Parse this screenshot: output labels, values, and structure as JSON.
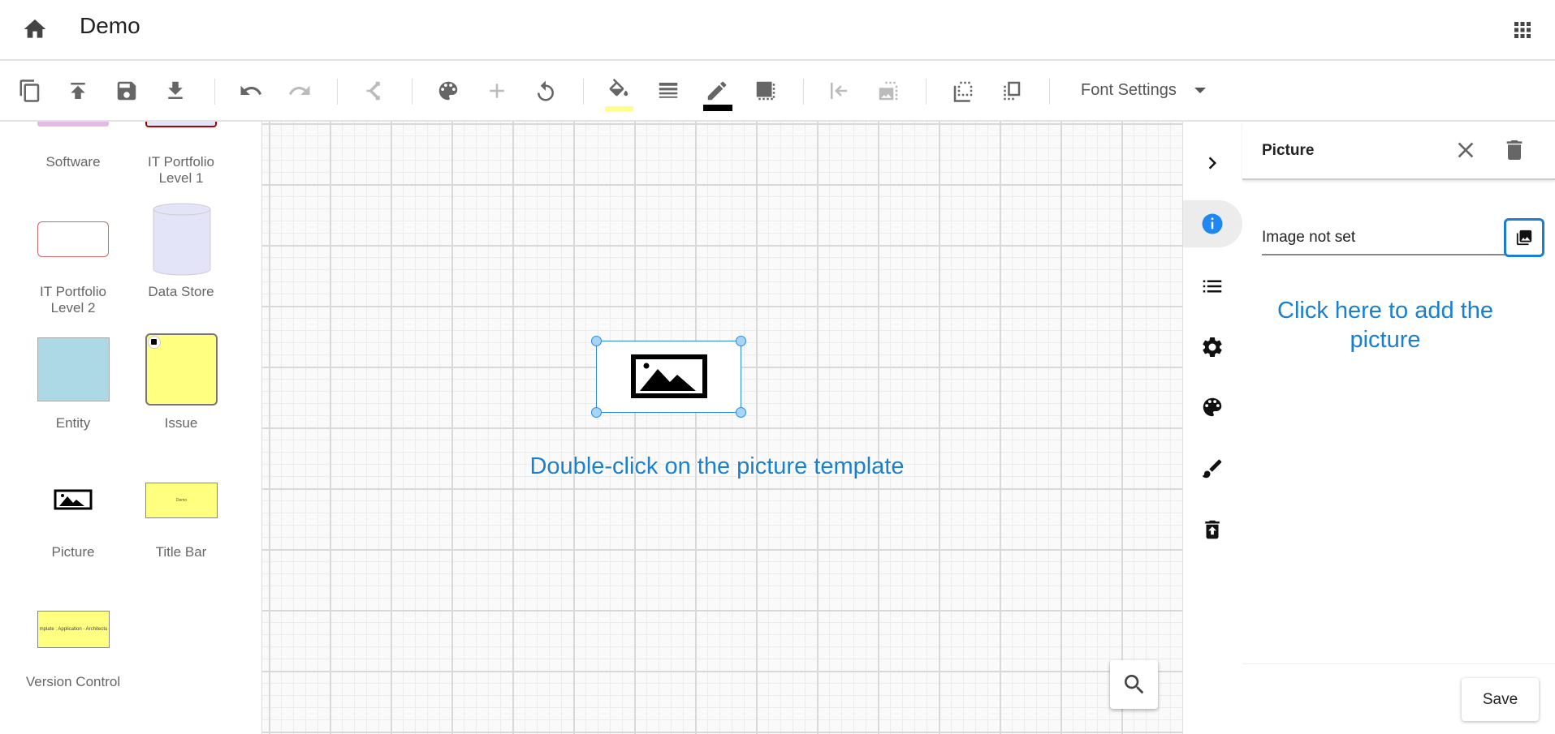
{
  "header": {
    "title": "Demo",
    "home_icon": "home-icon",
    "apps_icon": "apps-grid-icon"
  },
  "toolbar": {
    "icons": [
      "copy-icon",
      "upload-icon",
      "save-icon",
      "download-icon",
      "undo-icon",
      "redo-icon",
      "connector-icon",
      "palette-icon",
      "add-icon",
      "rotate-icon",
      "fill-color-icon",
      "line-style-icon",
      "line-color-icon",
      "shadow-icon",
      "align-left-icon",
      "image-size-icon",
      "send-back-icon",
      "bring-front-icon"
    ],
    "fill_color": "#ffff88",
    "line_color": "#000000",
    "font_settings_label": "Font Settings"
  },
  "palette": {
    "items": [
      {
        "label": "Software"
      },
      {
        "label": "IT Portfolio Level 1"
      },
      {
        "label": "IT Portfolio Level 2"
      },
      {
        "label": "Data Store"
      },
      {
        "label": "Entity"
      },
      {
        "label": "Issue"
      },
      {
        "label": "Picture"
      },
      {
        "label": "Title Bar",
        "shape_text": "Demo"
      },
      {
        "label": "Version Control",
        "shape_text": "mplate : Application - Architectu"
      }
    ]
  },
  "canvas": {
    "hint": "Double-click on the picture template",
    "accent": "#1a7fd0"
  },
  "side_icons": [
    "chevron-right-icon",
    "info-icon",
    "list-icon",
    "settings-icon",
    "palette-icon",
    "brush-icon",
    "delete-restore-icon"
  ],
  "panel": {
    "title": "Picture",
    "image_field_value": "Image not set",
    "hint": "Click here to add the picture",
    "save_label": "Save"
  }
}
